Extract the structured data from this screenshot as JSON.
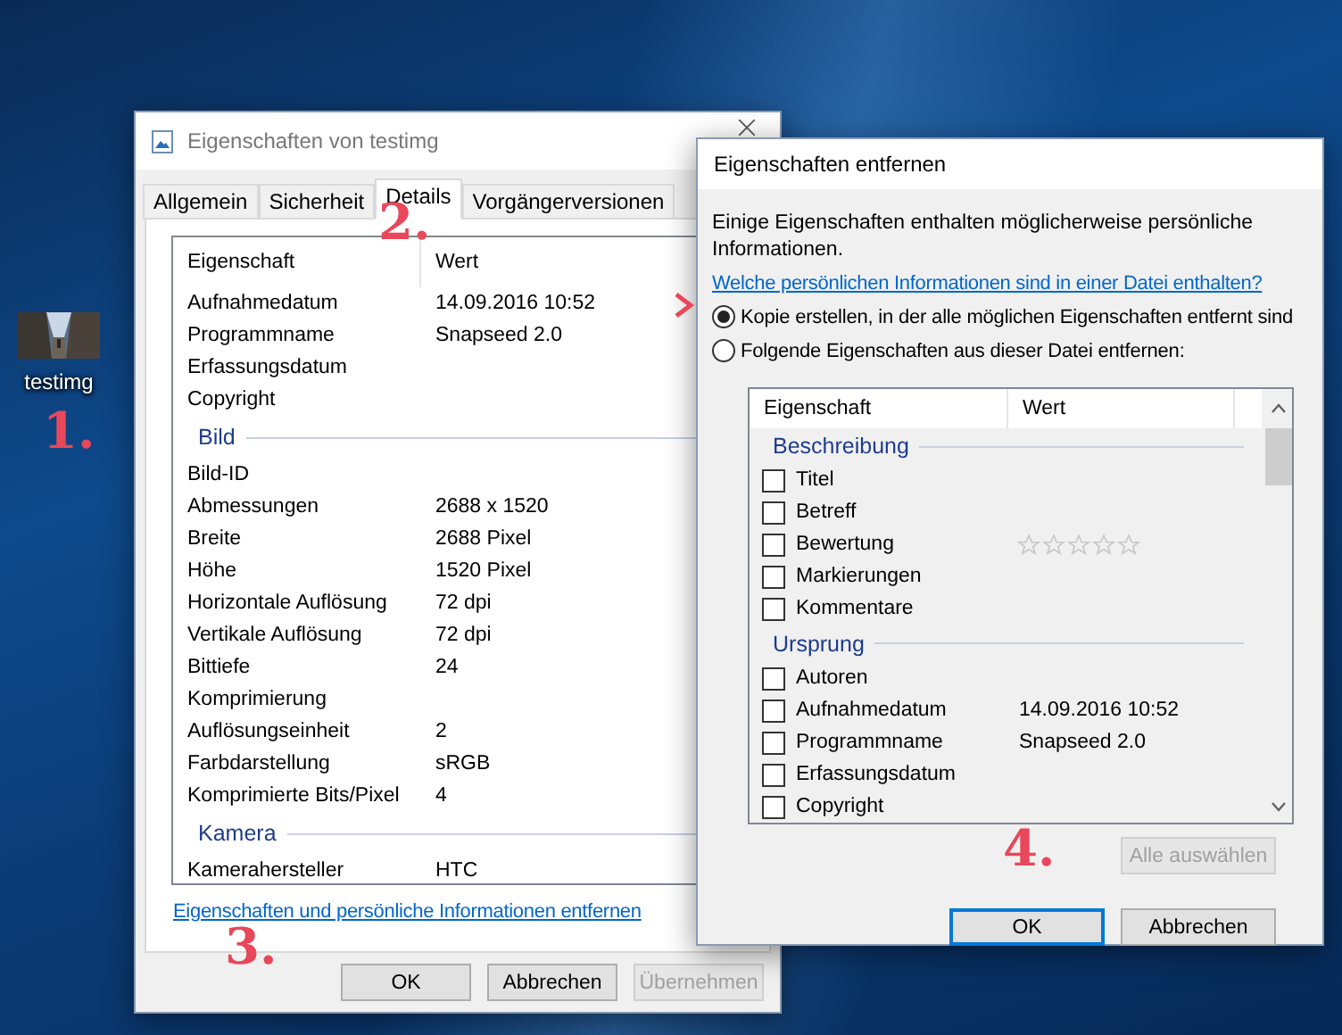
{
  "desktop_icon": {
    "label": "testimg"
  },
  "annotations": [
    "1.",
    "2.",
    "3.",
    "4."
  ],
  "properties_window": {
    "title": "Eigenschaften von testimg",
    "tabs": [
      {
        "label": "Allgemein",
        "selected": false
      },
      {
        "label": "Sicherheit",
        "selected": false
      },
      {
        "label": "Details",
        "selected": true
      },
      {
        "label": "Vorgängerversionen",
        "selected": false
      }
    ],
    "columns": [
      "Eigenschaft",
      "Wert"
    ],
    "rows": [
      {
        "kind": "item",
        "name": "Aufnahmedatum",
        "value": "14.09.2016 10:52"
      },
      {
        "kind": "item",
        "name": "Programmname",
        "value": "Snapseed 2.0"
      },
      {
        "kind": "item",
        "name": "Erfassungsdatum"
      },
      {
        "kind": "item",
        "name": "Copyright"
      },
      {
        "kind": "group",
        "name": "Bild"
      },
      {
        "kind": "item",
        "name": "Bild-ID"
      },
      {
        "kind": "item",
        "name": "Abmessungen",
        "value": "2688 x 1520"
      },
      {
        "kind": "item",
        "name": "Breite",
        "value": "2688 Pixel"
      },
      {
        "kind": "item",
        "name": "Höhe",
        "value": "1520 Pixel"
      },
      {
        "kind": "item",
        "name": "Horizontale Auflösung",
        "value": "72 dpi"
      },
      {
        "kind": "item",
        "name": "Vertikale Auflösung",
        "value": "72 dpi"
      },
      {
        "kind": "item",
        "name": "Bittiefe",
        "value": "24"
      },
      {
        "kind": "item",
        "name": "Komprimierung"
      },
      {
        "kind": "item",
        "name": "Auflösungseinheit",
        "value": "2"
      },
      {
        "kind": "item",
        "name": "Farbdarstellung",
        "value": "sRGB"
      },
      {
        "kind": "item",
        "name": "Komprimierte Bits/Pixel",
        "value": "4"
      },
      {
        "kind": "group",
        "name": "Kamera"
      },
      {
        "kind": "item",
        "name": "Kamerahersteller",
        "value": "HTC"
      }
    ],
    "link": "Eigenschaften und persönliche Informationen entfernen",
    "buttons": [
      {
        "label": "OK",
        "disabled": false
      },
      {
        "label": "Abbrechen",
        "disabled": false
      },
      {
        "label": "Übernehmen",
        "disabled": true
      }
    ]
  },
  "remove_dialog": {
    "title": "Eigenschaften entfernen",
    "intro": "Einige Eigenschaften enthalten möglicherweise persönliche Informationen.",
    "link": "Welche persönlichen Informationen sind in einer Datei enthalten?",
    "options": [
      {
        "label": "Kopie erstellen, in der alle möglichen Eigenschaften entfernt sind",
        "selected": true
      },
      {
        "label": "Folgende Eigenschaften aus dieser Datei entfernen:",
        "selected": false
      }
    ],
    "columns": [
      "Eigenschaft",
      "Wert"
    ],
    "rows": [
      {
        "kind": "group",
        "name": "Beschreibung"
      },
      {
        "kind": "item",
        "name": "Titel",
        "checked": false
      },
      {
        "kind": "item",
        "name": "Betreff",
        "checked": false
      },
      {
        "kind": "rating",
        "name": "Bewertung",
        "checked": false,
        "stars": 0
      },
      {
        "kind": "item",
        "name": "Markierungen",
        "checked": false
      },
      {
        "kind": "item",
        "name": "Kommentare",
        "checked": false
      },
      {
        "kind": "group",
        "name": "Ursprung"
      },
      {
        "kind": "item",
        "name": "Autoren",
        "checked": false
      },
      {
        "kind": "item",
        "name": "Aufnahmedatum",
        "checked": false,
        "value": "14.09.2016 10:52"
      },
      {
        "kind": "item",
        "name": "Programmname",
        "checked": false,
        "value": "Snapseed 2.0"
      },
      {
        "kind": "item",
        "name": "Erfassungsdatum",
        "checked": false
      },
      {
        "kind": "item",
        "name": "Copyright",
        "checked": false
      }
    ],
    "select_all": {
      "label": "Alle auswählen",
      "disabled": true
    },
    "buttons": [
      {
        "label": "OK",
        "default": true
      },
      {
        "label": "Abbrechen",
        "default": false
      }
    ]
  }
}
